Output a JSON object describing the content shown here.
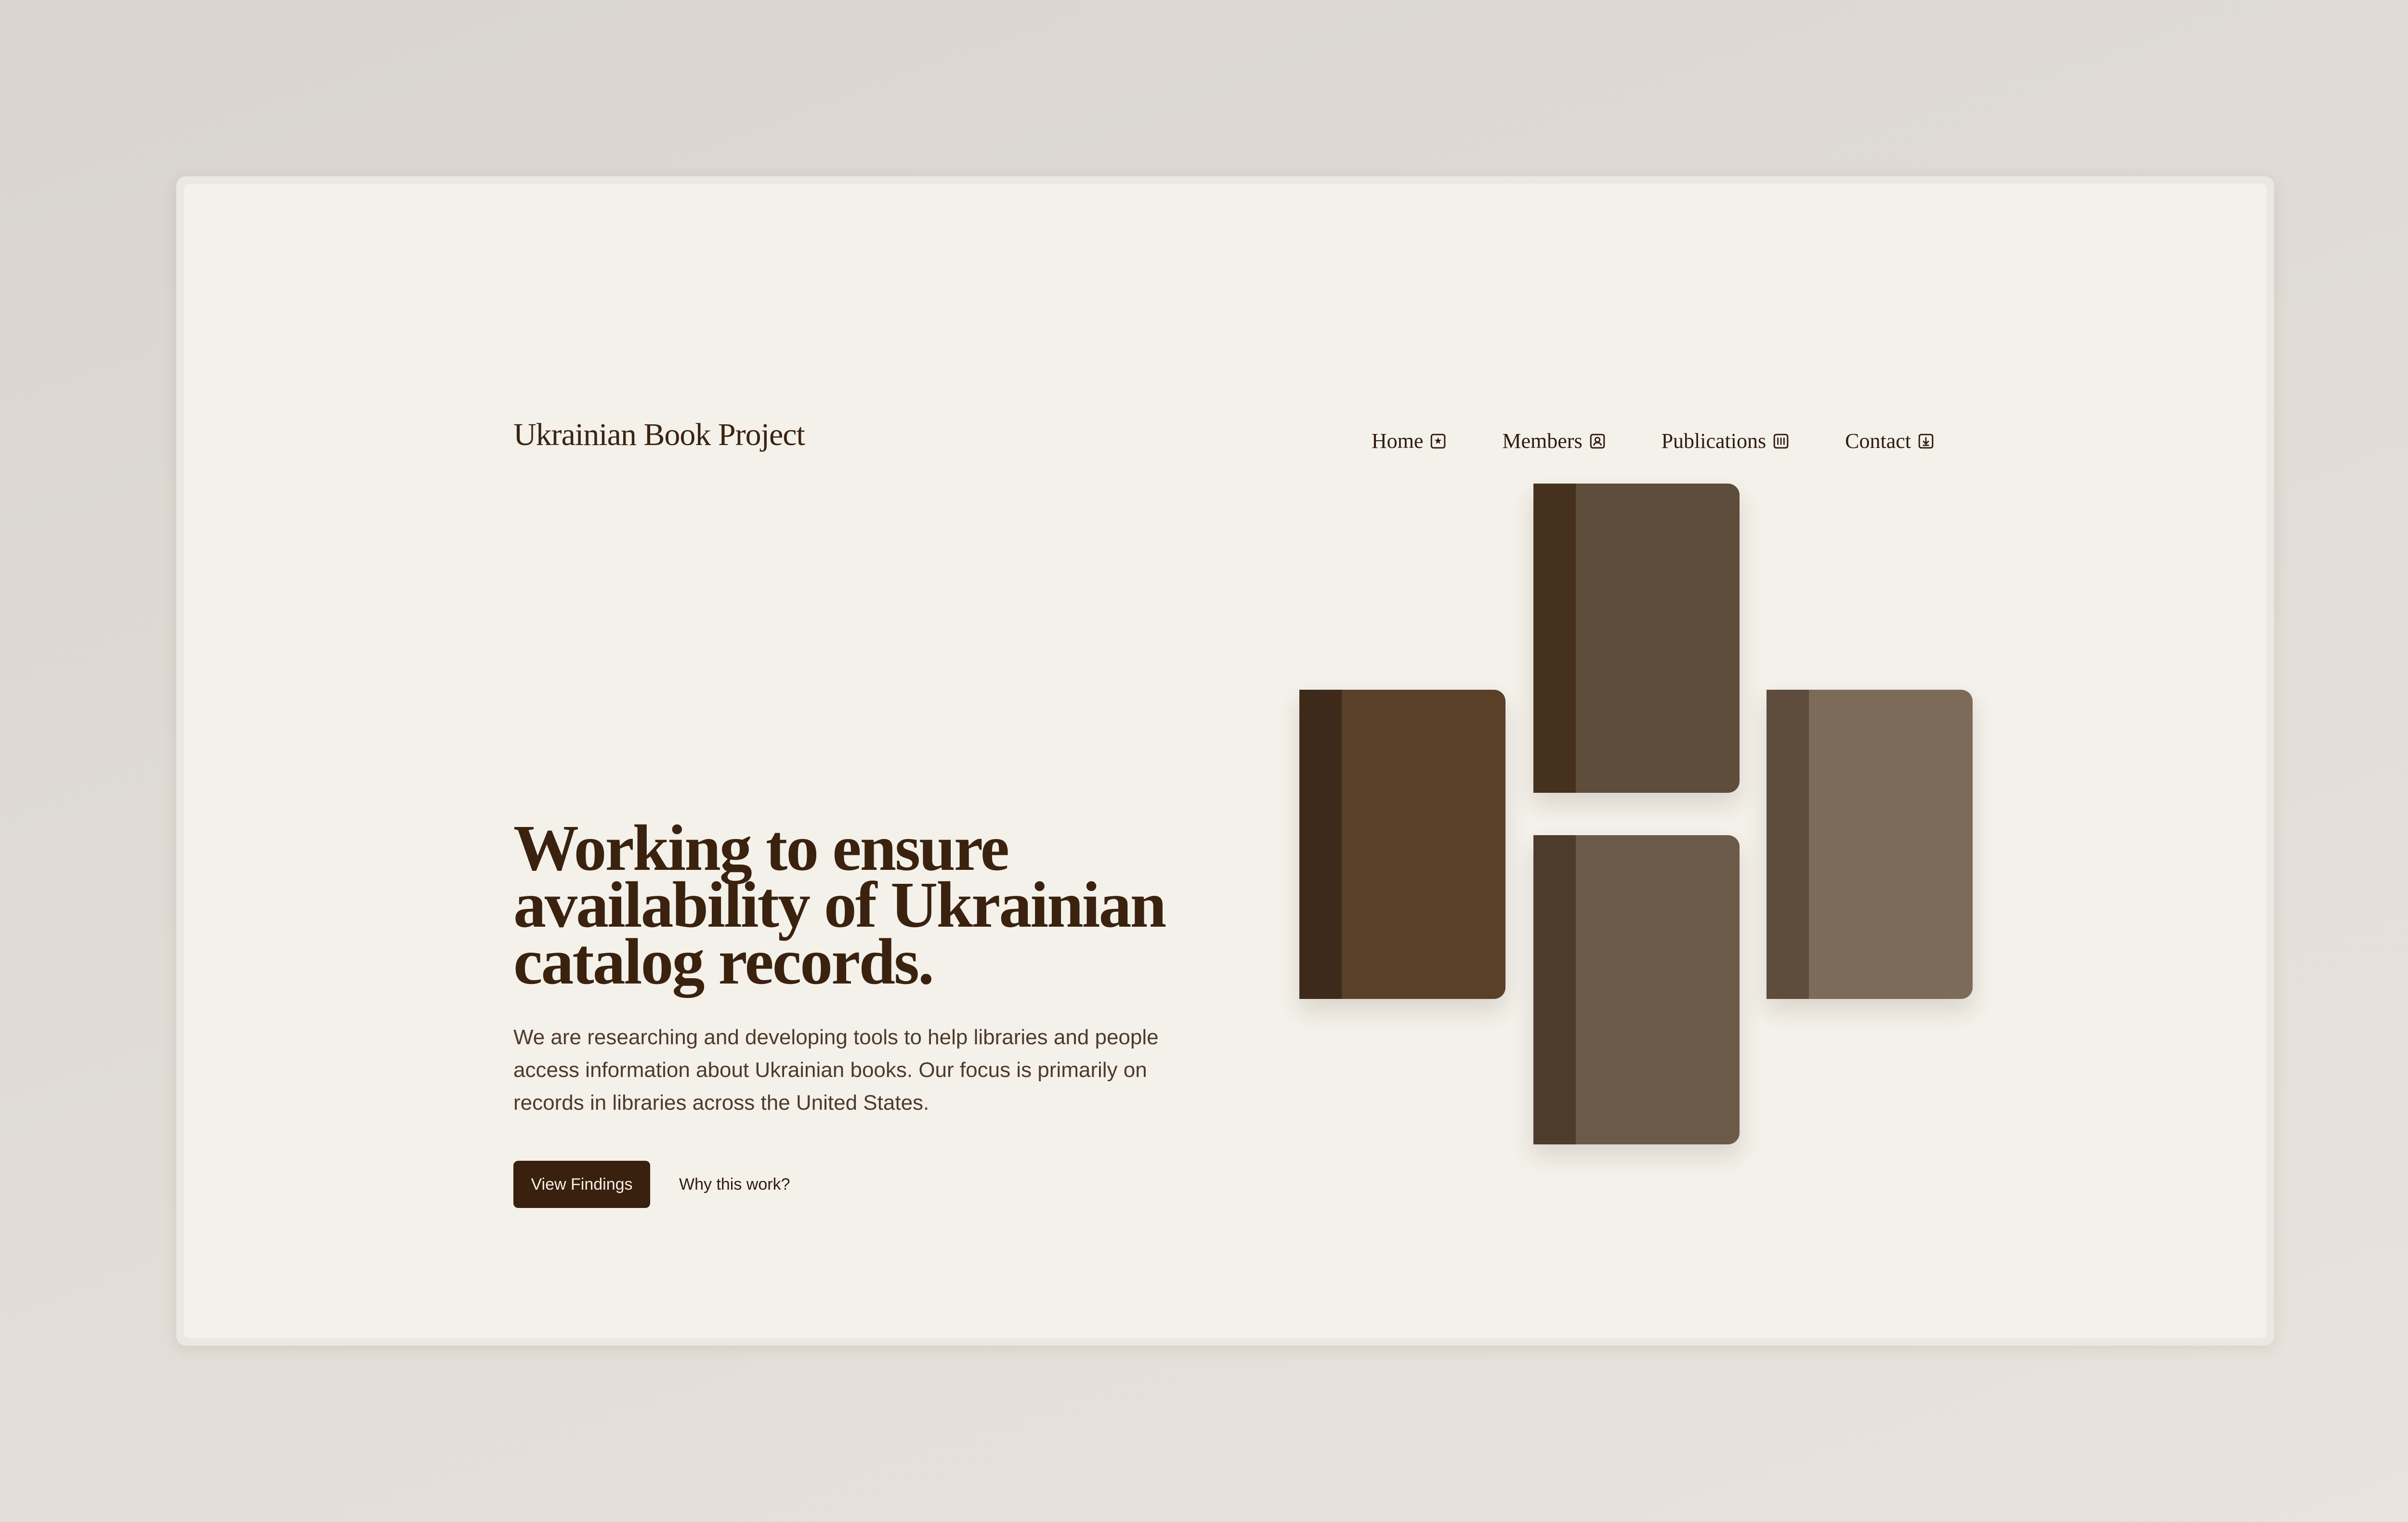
{
  "site": {
    "title": "Ukrainian Book Project"
  },
  "nav": {
    "items": [
      {
        "label": "Home",
        "icon": "home-icon"
      },
      {
        "label": "Members",
        "icon": "members-icon"
      },
      {
        "label": "Publications",
        "icon": "publications-icon"
      },
      {
        "label": "Contact",
        "icon": "contact-icon"
      }
    ]
  },
  "hero": {
    "title": "Working to ensure availability of Ukrainian catalog records.",
    "description": "We are researching and developing tools to help libraries and people access information about Ukrainian books. Our focus is primarily on records in libraries across the United States.",
    "primary_button": "View Findings",
    "secondary_link": "Why this work?"
  },
  "illustration": {
    "books": [
      {
        "name": "book-left",
        "cover": "#5a3f29",
        "spine": "#3e2a1b"
      },
      {
        "name": "book-top",
        "cover": "#5e4d3b",
        "spine": "#46301e"
      },
      {
        "name": "book-bottom",
        "cover": "#6b5a48",
        "spine": "#4d3b2c"
      },
      {
        "name": "book-right",
        "cover": "#7d6b5a",
        "spine": "#5e4d3c"
      }
    ]
  },
  "colors": {
    "page_background": "#f4f1ea",
    "text_primary": "#3a220f",
    "button_background": "#3a200e",
    "button_text": "#f4efe6"
  }
}
